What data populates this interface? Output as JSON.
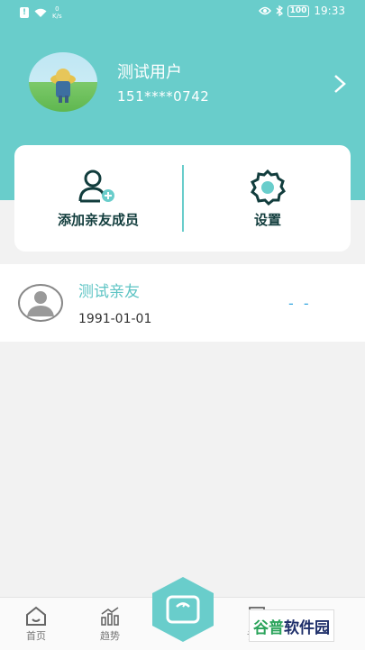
{
  "status_bar": {
    "alert": "!",
    "speed": "0",
    "speed_unit": "K/s",
    "battery": "100",
    "time": "19:33"
  },
  "profile": {
    "name": "测试用户",
    "phone": "151****0742"
  },
  "actions": {
    "add_member": "添加亲友成员",
    "settings": "设置"
  },
  "member": {
    "name": "测试亲友",
    "birthday": "1991-01-01",
    "value": "- -"
  },
  "tabbar": {
    "home": "首页",
    "trend": "趋势",
    "report": "记录"
  },
  "watermark": {
    "part1": "谷普",
    "part2": "软件园"
  },
  "colors": {
    "accent": "#69cdcb",
    "dark": "#123d3d",
    "value": "#3aa9e0"
  }
}
